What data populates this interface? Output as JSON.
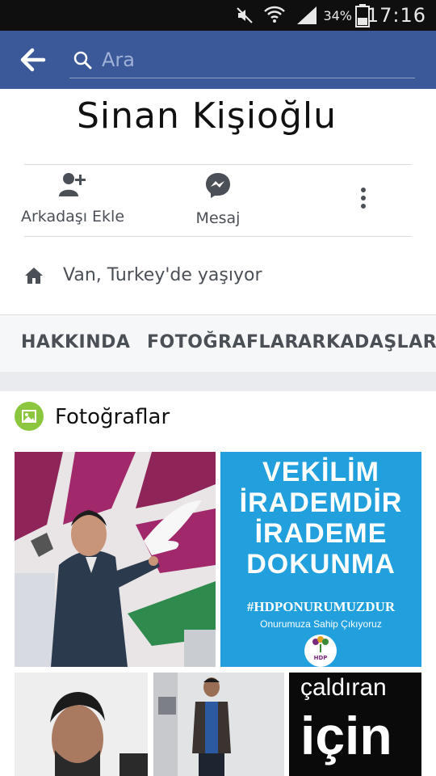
{
  "status_bar": {
    "battery_percent": "34%",
    "time": "17:16",
    "icons": [
      "mute-icon",
      "wifi-icon",
      "signal-icon",
      "battery-icon"
    ]
  },
  "top_bar": {
    "search_placeholder": "Ara",
    "icons": [
      "back-arrow-icon",
      "search-icon"
    ],
    "color": "#3b5998"
  },
  "profile": {
    "name": "Sinan Kişioğlu"
  },
  "actions": {
    "add_friend": "Arkadaşı Ekle",
    "message": "Mesaj",
    "icons": [
      "add-friend-icon",
      "messenger-icon",
      "more-icon"
    ]
  },
  "lives_in": {
    "text": "Van, Turkey'de yaşıyor",
    "icon": "home-icon"
  },
  "tabs": [
    "HAKKINDA",
    "FOTOĞRAFLAR",
    "ARKADAŞLAR"
  ],
  "photos": {
    "title": "Fotoğraflar",
    "blue_card": {
      "lines": [
        "VEKİLİM",
        "İRADEMDİR",
        "İRADEME",
        "DOKUNMA"
      ],
      "hashtag": "#HDPONURUMUZDUR",
      "sub": "Onurumuza Sahip Çıkıyoruz",
      "logo_text": "HDP"
    },
    "black_card": {
      "line1": "çaldıran",
      "line2": "için"
    }
  }
}
